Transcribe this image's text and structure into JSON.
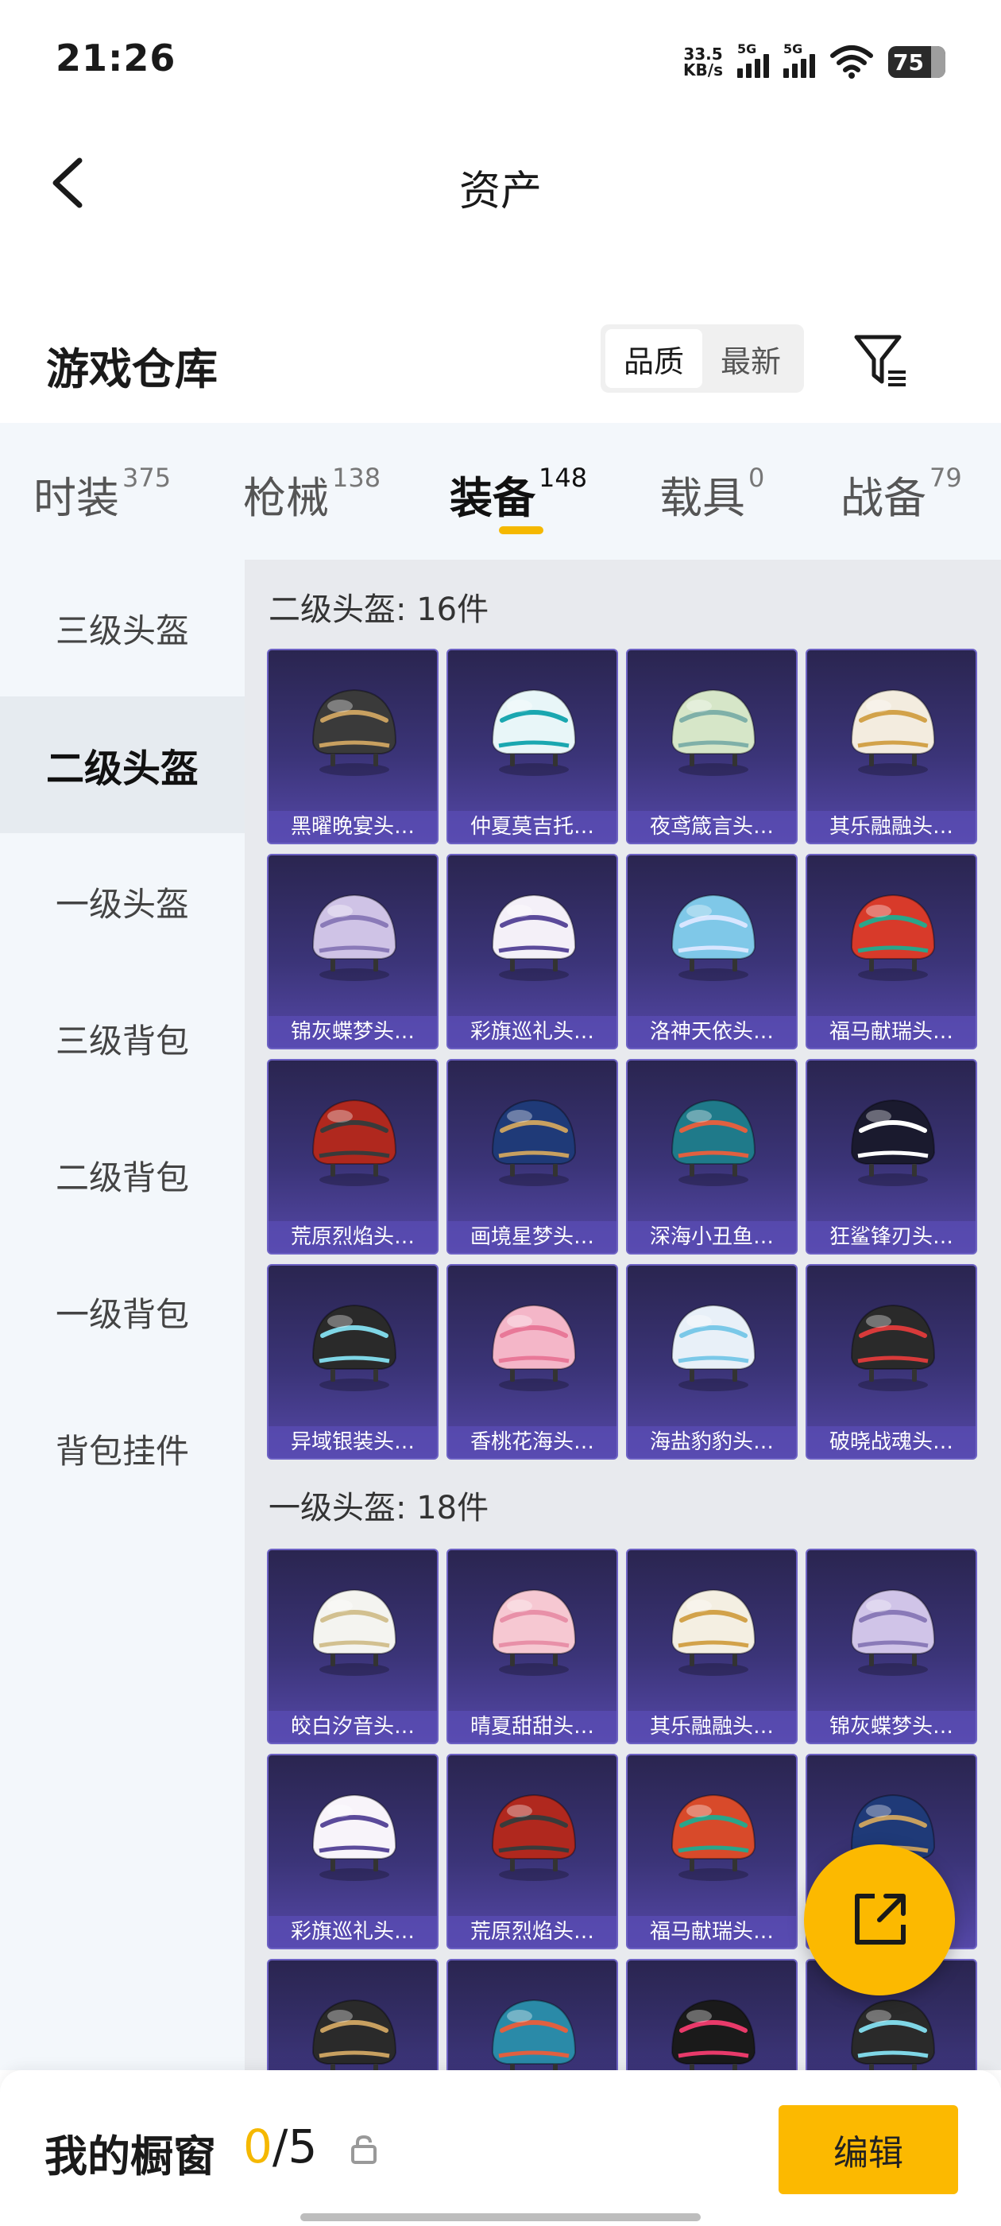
{
  "status_bar": {
    "time": "21:26",
    "net_speed_value": "33.5",
    "net_speed_unit": "KB/s",
    "signal1_label": "5G",
    "signal2_label": "5G",
    "battery": "75"
  },
  "nav": {
    "title": "资产"
  },
  "warehouse": {
    "label": "游戏仓库",
    "sort_options": [
      "品质",
      "最新"
    ],
    "sort_selected": "品质"
  },
  "tabs": [
    {
      "label": "时装",
      "count": "375"
    },
    {
      "label": "枪械",
      "count": "138"
    },
    {
      "label": "装备",
      "count": "148",
      "active": true
    },
    {
      "label": "载具",
      "count": "0"
    },
    {
      "label": "战备",
      "count": "79"
    }
  ],
  "sidebar": {
    "items": [
      "三级头盔",
      "二级头盔",
      "一级头盔",
      "三级背包",
      "二级背包",
      "一级背包",
      "背包挂件"
    ],
    "active": "二级头盔"
  },
  "sections": [
    {
      "title": "二级头盔: 16件",
      "items": [
        {
          "name": "黑曜晚宴头…",
          "color": "#3a3a3a",
          "accent": "#c8a060"
        },
        {
          "name": "仲夏莫吉托…",
          "color": "#e8f6f8",
          "accent": "#1aa7b0"
        },
        {
          "name": "夜鸢箴言头…",
          "color": "#d6e6c8",
          "accent": "#7fb0a8"
        },
        {
          "name": "其乐融融头…",
          "color": "#f3ecdf",
          "accent": "#d2a24a"
        },
        {
          "name": "锦灰蝶梦头…",
          "color": "#cfc3e6",
          "accent": "#8a7ab8"
        },
        {
          "name": "彩旗巡礼头…",
          "color": "#f4f0f8",
          "accent": "#5b4a9a"
        },
        {
          "name": "洛神天依头…",
          "color": "#7fc8e8",
          "accent": "#d8e6ff"
        },
        {
          "name": "福马献瑞头…",
          "color": "#d83a2a",
          "accent": "#2aa58a"
        },
        {
          "name": "荒原烈焰头…",
          "color": "#b0281e",
          "accent": "#3a3a3a"
        },
        {
          "name": "画境星梦头…",
          "color": "#1f3a78",
          "accent": "#c8a060"
        },
        {
          "name": "深海小丑鱼…",
          "color": "#1f7a8a",
          "accent": "#e06040"
        },
        {
          "name": "狂鲨锋刃头…",
          "color": "#1a1a2e",
          "accent": "#ffffff"
        },
        {
          "name": "异域银装头…",
          "color": "#2a2a2a",
          "accent": "#7fd6e6"
        },
        {
          "name": "香桃花海头…",
          "color": "#f4b6c8",
          "accent": "#e87898"
        },
        {
          "name": "海盐豹豹头…",
          "color": "#e8f0f8",
          "accent": "#7ac8e8"
        },
        {
          "name": "破晓战魂头…",
          "color": "#2a2a2a",
          "accent": "#d83a3a"
        }
      ]
    },
    {
      "title": "一级头盔: 18件",
      "items": [
        {
          "name": "皎白汐音头…",
          "color": "#f4f4f0",
          "accent": "#d2c090"
        },
        {
          "name": "晴夏甜甜头…",
          "color": "#f6c8d2",
          "accent": "#e890a8"
        },
        {
          "name": "其乐融融头…",
          "color": "#f4efe2",
          "accent": "#d2a24a"
        },
        {
          "name": "锦灰蝶梦头…",
          "color": "#d0c4e8",
          "accent": "#8a7ab8"
        },
        {
          "name": "彩旗巡礼头…",
          "color": "#f8f4fa",
          "accent": "#5b4a9a"
        },
        {
          "name": "荒原烈焰头…",
          "color": "#b0281e",
          "accent": "#3a3a3a"
        },
        {
          "name": "福马献瑞头…",
          "color": "#d84a2a",
          "accent": "#2aa58a"
        },
        {
          "name": "",
          "color": "#1f3a78",
          "accent": "#c8a060"
        },
        {
          "name": "",
          "color": "#2a2a2a",
          "accent": "#c8a060"
        },
        {
          "name": "",
          "color": "#2a8aa8",
          "accent": "#e06040"
        },
        {
          "name": "",
          "color": "#1a1a1a",
          "accent": "#e83a6a"
        },
        {
          "name": "",
          "color": "#2a2a2a",
          "accent": "#7fd6e6"
        }
      ]
    }
  ],
  "showcase": {
    "label": "我的橱窗",
    "current": "0",
    "max": "/5",
    "edit_label": "编辑"
  }
}
